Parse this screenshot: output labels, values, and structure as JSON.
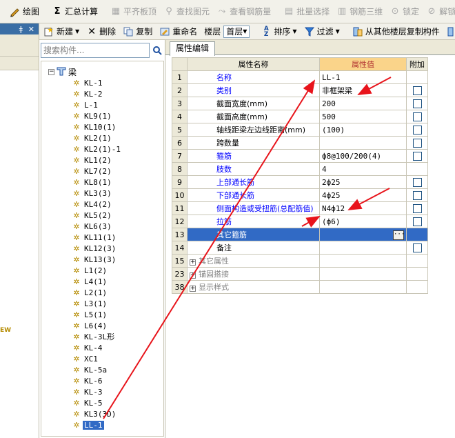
{
  "toolbar1": {
    "draw": "绘图",
    "sum_calc": "汇总计算",
    "flat_slab": "平齐板顶",
    "find_element": "查找图元",
    "view_rebar": "查看钢筋量",
    "batch_select": "批量选择",
    "rebar_3d": "钢筋三维",
    "lock": "锁定",
    "unlock": "解锁",
    "batch": "批"
  },
  "leftstrip": {
    "pin": "ǂ",
    "close": "✕",
    "partial_text": "EW"
  },
  "toolbar2": {
    "new": "新建",
    "delete": "删除",
    "copy": "复制",
    "rename": "重命名",
    "floor_label": "楼层",
    "floor_value": "首层",
    "sort": "排序",
    "filter": "过滤",
    "copy_from_floor": "从其他楼层复制构件"
  },
  "tree": {
    "search_placeholder": "搜索构件...",
    "root": "梁",
    "items": [
      "KL-1",
      "KL-2",
      "L-1",
      "KL9(1)",
      "KL10(1)",
      "KL2(1)",
      "KL2(1)-1",
      "KL1(2)",
      "KL7(2)",
      "KL8(1)",
      "KL3(3)",
      "KL4(2)",
      "KL5(2)",
      "KL6(3)",
      "KL11(1)",
      "KL12(3)",
      "KL13(3)",
      "L1(2)",
      "L4(1)",
      "L2(1)",
      "L3(1)",
      "L5(1)",
      "L6(4)",
      "KL-3L形",
      "KL-4",
      "XC1",
      "KL-5a",
      "KL-6",
      "KL-3",
      "KL-5",
      "KL3(3D)",
      "LL-1"
    ],
    "selected": "LL-1"
  },
  "properties": {
    "tab": "属性编辑",
    "headers": {
      "name": "属性名称",
      "value": "属性值",
      "extra": "附加"
    },
    "rows": [
      {
        "num": "1",
        "name": "名称",
        "value": "LL-1",
        "checkbox": false,
        "style": "blue"
      },
      {
        "num": "2",
        "name": "类别",
        "value": "非框架梁",
        "checkbox": true,
        "style": "blue"
      },
      {
        "num": "3",
        "name": "截面宽度(mm)",
        "value": "200",
        "checkbox": true,
        "style": "black"
      },
      {
        "num": "4",
        "name": "截面高度(mm)",
        "value": "500",
        "checkbox": true,
        "style": "black"
      },
      {
        "num": "5",
        "name": "轴线距梁左边线距离(mm)",
        "value": "(100)",
        "checkbox": true,
        "style": "black"
      },
      {
        "num": "6",
        "name": "跨数量",
        "value": "",
        "checkbox": true,
        "style": "black"
      },
      {
        "num": "7",
        "name": "箍筋",
        "value": "ф8@100/200(4)",
        "checkbox": true,
        "style": "blue"
      },
      {
        "num": "8",
        "name": "肢数",
        "value": "4",
        "checkbox": false,
        "style": "blue"
      },
      {
        "num": "9",
        "name": "上部通长筋",
        "value": "2ф25",
        "checkbox": true,
        "style": "blue"
      },
      {
        "num": "10",
        "name": "下部通长筋",
        "value": "4ф25",
        "checkbox": true,
        "style": "blue"
      },
      {
        "num": "11",
        "name": "侧面构造或受扭筋(总配筋值)",
        "value": "N4ф12",
        "checkbox": true,
        "style": "blue"
      },
      {
        "num": "12",
        "name": "拉筋",
        "value": "(ф6)",
        "checkbox": true,
        "style": "blue"
      },
      {
        "num": "13",
        "name": "其它箍筋",
        "value": "",
        "checkbox": false,
        "style": "selected"
      },
      {
        "num": "14",
        "name": "备注",
        "value": "",
        "checkbox": true,
        "style": "black"
      },
      {
        "num": "15",
        "name": "其它属性",
        "value": "",
        "checkbox": false,
        "style": "group"
      },
      {
        "num": "23",
        "name": "锚固搭接",
        "value": "",
        "checkbox": false,
        "style": "group"
      },
      {
        "num": "38",
        "name": "显示样式",
        "value": "",
        "checkbox": false,
        "style": "group"
      }
    ],
    "expand_symbol": "+",
    "ellipsis": "···"
  },
  "colors": {
    "annotation_red": "#e8141b",
    "selection_blue": "#316ac5",
    "header_orange": "#fad48a"
  }
}
